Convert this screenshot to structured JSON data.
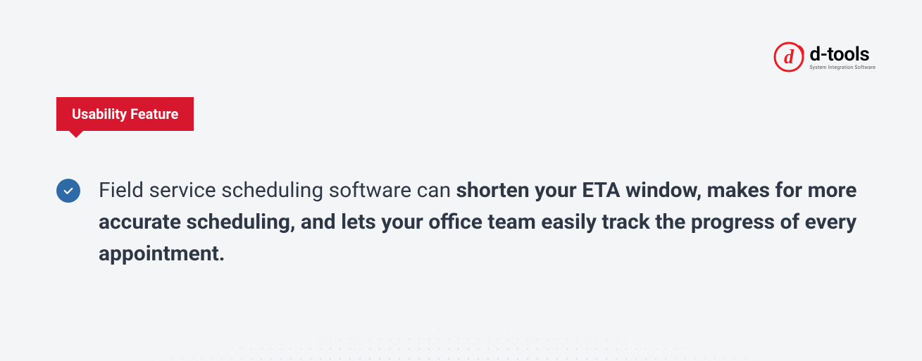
{
  "brand": {
    "name": "d-tools",
    "tagline": "System Integration Software",
    "accent": "#ed1c24"
  },
  "badge": {
    "label": "Usability Feature"
  },
  "content": {
    "lead": "Field service scheduling software can ",
    "strong": "shorten your ETA window, makes for more accurate scheduling, and lets your office team easily track the progress of every appointment.",
    "icon": "check-circle-icon"
  }
}
